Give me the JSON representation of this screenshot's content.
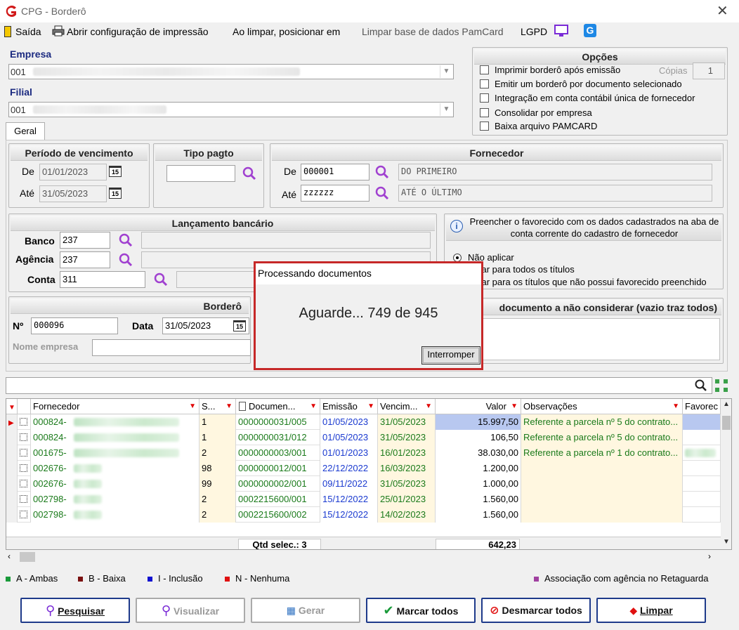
{
  "window": {
    "title": "CPG - Borderô"
  },
  "menu": {
    "exit": "Saída",
    "print_config": "Abrir configuração de impressão",
    "on_clear": "Ao limpar, posicionar em",
    "clear_pamcard": "Limpar base de dados PamCard",
    "lgpd": "LGPD"
  },
  "empresa": {
    "label": "Empresa",
    "value": "001"
  },
  "filial": {
    "label": "Filial",
    "value": "001"
  },
  "opcoes": {
    "title": "Opções",
    "items": [
      "Imprimir borderô após emissão",
      "Emitir um borderô por documento selecionado",
      "Integração em conta contábil única de fornecedor",
      "Consolidar por empresa",
      "Baixa arquivo PAMCARD"
    ],
    "copies_label": "Cópias",
    "copies_value": "1"
  },
  "tabs": [
    "Geral"
  ],
  "periodo": {
    "title": "Período de vencimento",
    "de_label": "De",
    "de": "01/01/2023",
    "ate_label": "Até",
    "ate": "31/05/2023"
  },
  "tipo_pagto": {
    "title": "Tipo pagto"
  },
  "fornecedor": {
    "title": "Fornecedor",
    "de_label": "De",
    "de_code": "000001",
    "de_name": "DO PRIMEIRO",
    "ate_label": "Até",
    "ate_code": "zzzzzz",
    "ate_name": "ATÉ O ÚLTIMO"
  },
  "lancamento": {
    "title": "Lançamento bancário",
    "banco_label": "Banco",
    "banco": "237",
    "agencia_label": "Agência",
    "agencia": "237",
    "conta_label": "Conta",
    "conta": "311"
  },
  "favorecido": {
    "info": "Preencher o favorecido com os dados cadastrados na aba de conta corrente do cadastro de fornecedor",
    "opt1": "Não aplicar",
    "opt2": "car para todos os títulos",
    "opt3": "car para os títulos que não possui favorecido preenchido"
  },
  "bordero": {
    "title": "Borderô",
    "n_label": "Nº",
    "n": "000096",
    "data_label": "Data",
    "data": "31/05/2023",
    "nome_label": "Nome empresa"
  },
  "doc_excluir": {
    "title": "documento a não considerar (vazio traz todos)"
  },
  "calendar_icon_text": "15",
  "grid": {
    "headers": [
      "Fornecedor",
      "S...",
      "Documen...",
      "Emissão",
      "Vencim...",
      "Valor",
      "Observações",
      "Favorec"
    ],
    "rows": [
      {
        "fornecedor": "000824-",
        "s": "1",
        "doc": "0000000031/005",
        "emissao": "01/05/2023",
        "venc": "31/05/2023",
        "valor": "15.997,50",
        "obs": "Referente a parcela nº 5 do contrato..."
      },
      {
        "fornecedor": "000824-",
        "s": "1",
        "doc": "0000000031/012",
        "emissao": "01/05/2023",
        "venc": "31/05/2023",
        "valor": "106,50",
        "obs": "Referente a parcela nº 5 do contrato..."
      },
      {
        "fornecedor": "001675-",
        "s": "2",
        "doc": "0000000003/001",
        "emissao": "01/01/2023",
        "venc": "16/01/2023",
        "valor": "38.030,00",
        "obs": "Referente a parcela nº 1 do contrato..."
      },
      {
        "fornecedor": "002676-",
        "s": "98",
        "doc": "0000000012/001",
        "emissao": "22/12/2022",
        "venc": "16/03/2023",
        "valor": "1.200,00",
        "obs": ""
      },
      {
        "fornecedor": "002676-",
        "s": "99",
        "doc": "0000000002/001",
        "emissao": "09/11/2022",
        "venc": "31/05/2023",
        "valor": "1.000,00",
        "obs": ""
      },
      {
        "fornecedor": "002798-",
        "s": "2",
        "doc": "0002215600/001",
        "emissao": "15/12/2022",
        "venc": "25/01/2023",
        "valor": "1.560,00",
        "obs": ""
      },
      {
        "fornecedor": "002798-",
        "s": "2",
        "doc": "0002215600/002",
        "emissao": "15/12/2022",
        "venc": "14/02/2023",
        "valor": "1.560,00",
        "obs": ""
      }
    ],
    "footer_qtd": "Qtd selec.: 3",
    "footer_total": "642,23"
  },
  "legend": {
    "a": "A - Ambas",
    "b": "B - Baixa",
    "i": "I - Inclusão",
    "n": "N - Nenhuma",
    "assoc": "Associação com agência no Retaguarda",
    "colors": {
      "a": "#1a9a3a",
      "b": "#7a1010",
      "i": "#1010d0",
      "n": "#e01010",
      "assoc": "#a040a0"
    }
  },
  "buttons": {
    "pesquisar": "Pesquisar",
    "visualizar": "Visualizar",
    "gerar": "Gerar",
    "marcar": "Marcar todos",
    "desmarcar": "Desmarcar todos",
    "limpar": "Limpar"
  },
  "dialog": {
    "title": "Processando documentos",
    "message": "Aguarde... 749 de 945",
    "button": "Interromper"
  }
}
